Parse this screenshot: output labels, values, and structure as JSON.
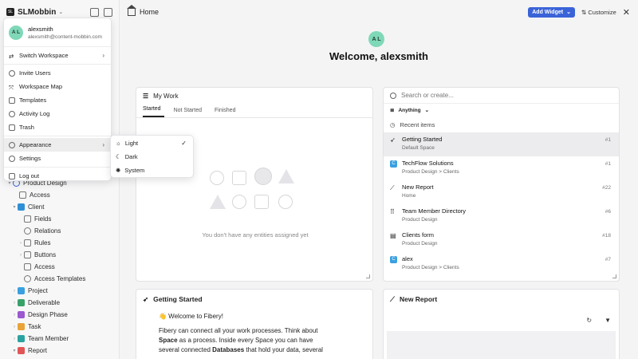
{
  "workspace": {
    "logo": "SL",
    "name": "SLMobbin"
  },
  "topbar": {
    "title": "Home",
    "add_widget": "Add Widget",
    "customize": "Customize"
  },
  "welcome": {
    "initials": "A L",
    "text": "Welcome, alexsmith"
  },
  "my_work": {
    "title": "My Work",
    "tabs": [
      "Started",
      "Not Started",
      "Finished"
    ],
    "empty_text": "You don't have any entities assigned yet"
  },
  "search": {
    "placeholder": "Search or create...",
    "filter": "Anything",
    "recent_label": "Recent items",
    "results": [
      {
        "title": "Getting Started",
        "sub": "Default Space",
        "num": "#1",
        "icon": "rocket-icon"
      },
      {
        "title": "TechFlow Solutions",
        "sub": "Product Design  >  Clients",
        "num": "#1",
        "icon": "client-c-icon"
      },
      {
        "title": "New Report",
        "sub": "Home",
        "num": "#22",
        "icon": "chart-line-icon"
      },
      {
        "title": "Team Member Directory",
        "sub": "Product Design",
        "num": "#6",
        "icon": "grid-icon"
      },
      {
        "title": "Clients form",
        "sub": "Product Design",
        "num": "#18",
        "icon": "form-icon"
      },
      {
        "title": "alex",
        "sub": "Product Design  >  Clients",
        "num": "#7",
        "icon": "client-c-icon"
      }
    ]
  },
  "getting_started": {
    "title": "Getting Started",
    "wave": "👋 Welcome to Fibery!",
    "body_1": "Fibery can connect all your work processes. Think about",
    "body_2a": "Space",
    "body_2b": " as a process. Inside every Space you can have",
    "body_3a": "several connected ",
    "body_3b": "Databases",
    "body_3c": " that hold your data, several"
  },
  "new_report": {
    "title": "New Report"
  },
  "menu": {
    "user": {
      "initials": "A L",
      "name": "alexsmith",
      "email": "alexsmith@content-mobbin.com"
    },
    "items": [
      {
        "label": "Switch Workspace"
      },
      {
        "label": "Invite Users"
      },
      {
        "label": "Workspace Map"
      },
      {
        "label": "Templates"
      },
      {
        "label": "Activity Log"
      },
      {
        "label": "Trash"
      },
      {
        "label": "Appearance"
      },
      {
        "label": "Settings"
      },
      {
        "label": "Log out"
      }
    ]
  },
  "appearance": {
    "options": [
      "Light",
      "Dark",
      "System"
    ],
    "selected": "Light"
  },
  "tree": [
    {
      "label": "Product Design"
    },
    {
      "label": "Access"
    },
    {
      "label": "Client"
    },
    {
      "label": "Fields"
    },
    {
      "label": "Relations"
    },
    {
      "label": "Rules"
    },
    {
      "label": "Buttons"
    },
    {
      "label": "Access"
    },
    {
      "label": "Access Templates"
    },
    {
      "label": "Project"
    },
    {
      "label": "Deliverable"
    },
    {
      "label": "Design Phase"
    },
    {
      "label": "Task"
    },
    {
      "label": "Team Member"
    },
    {
      "label": "Report"
    }
  ],
  "colors": {
    "accent": "#3a63d8",
    "avatar": "#7fd8b8"
  }
}
